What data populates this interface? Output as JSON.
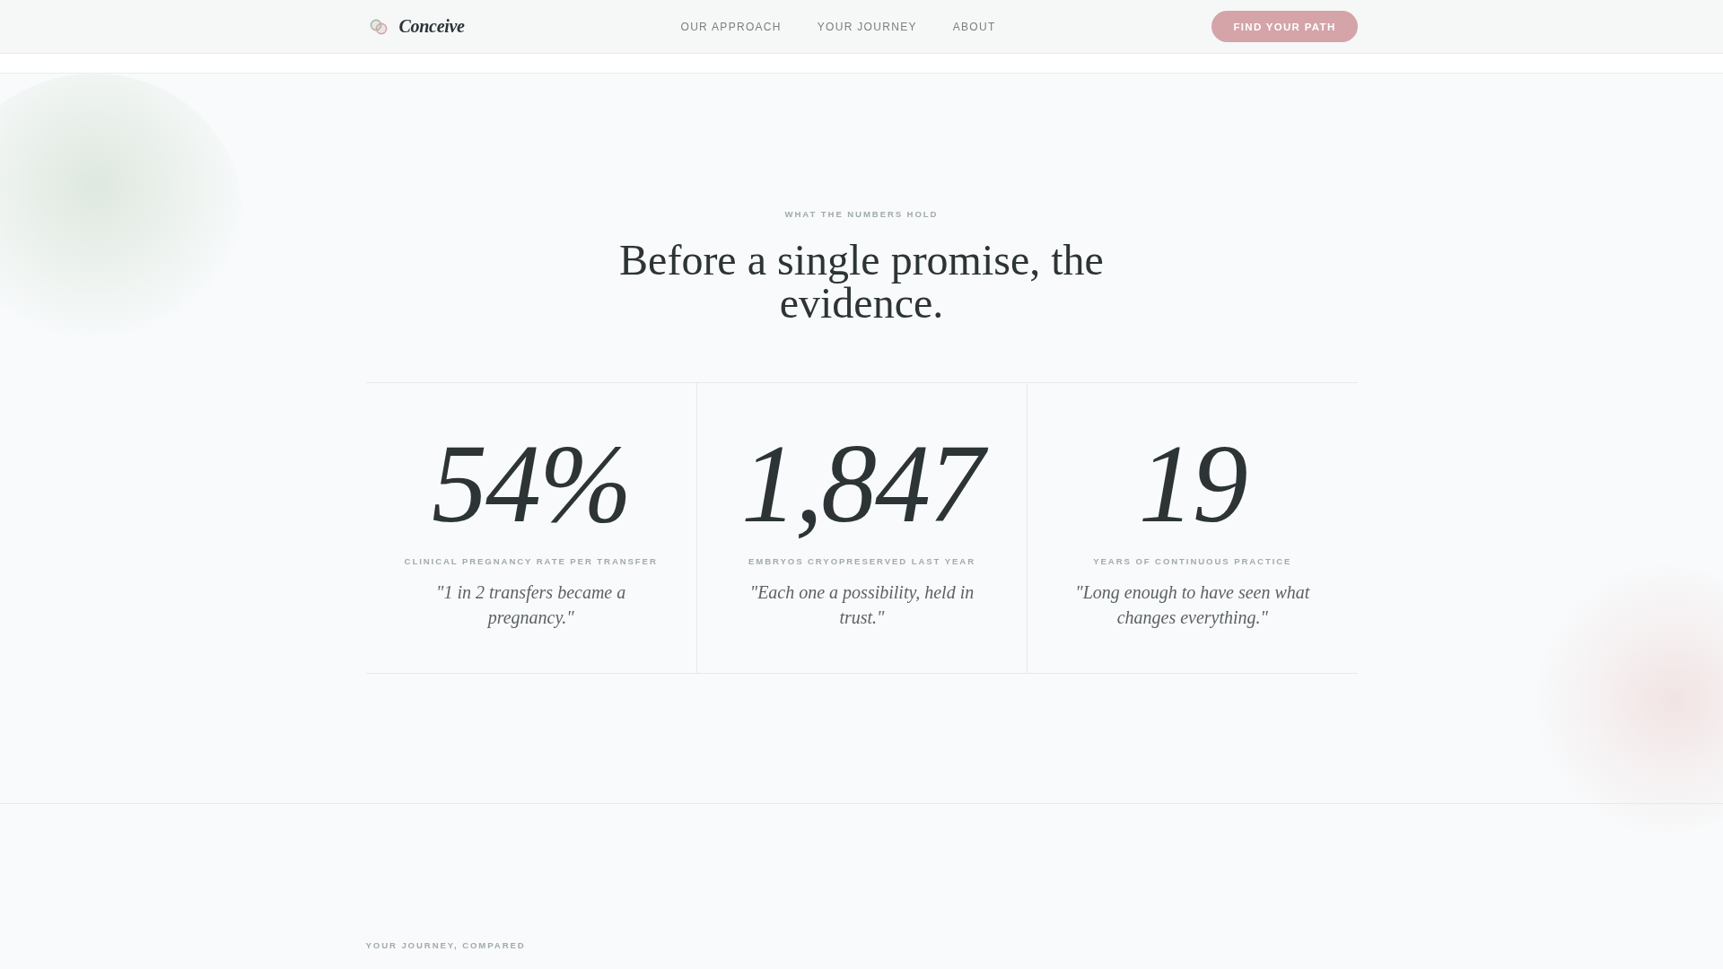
{
  "header": {
    "logo": "Conceive",
    "nav": [
      {
        "label": "OUR APPROACH"
      },
      {
        "label": "YOUR JOURNEY"
      },
      {
        "label": "ABOUT"
      }
    ],
    "cta": "FIND YOUR PATH"
  },
  "stats_section": {
    "eyebrow": "WHAT THE NUMBERS HOLD",
    "heading": "Before a single promise, the evidence.",
    "stats": [
      {
        "value": "54%",
        "label": "CLINICAL PREGNANCY RATE PER TRANSFER",
        "quote": "\"1 in 2 transfers became a pregnancy.\""
      },
      {
        "value": "1,847",
        "label": "EMBRYOS CRYOPRESERVED LAST YEAR",
        "quote": "\"Each one a possibility, held in trust.\""
      },
      {
        "value": "19",
        "label": "YEARS OF CONTINUOUS PRACTICE",
        "quote": "\"Long enough to have seen what changes everything.\""
      }
    ]
  },
  "next_section": {
    "eyebrow": "YOUR JOURNEY, COMPARED"
  }
}
